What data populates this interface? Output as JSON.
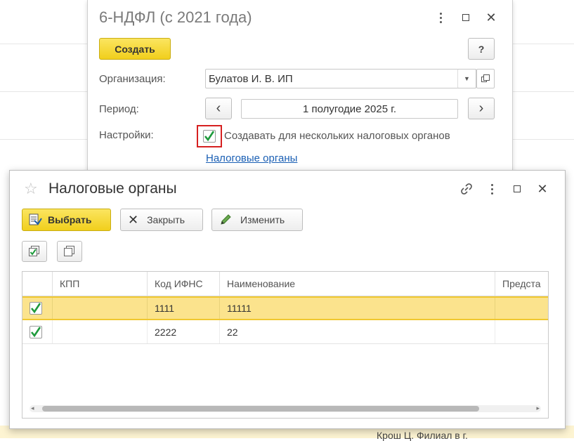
{
  "back_form": {
    "title": "6-НДФЛ (с 2021 года)",
    "create_label": "Создать",
    "help_label": "?",
    "org_label": "Организация:",
    "org_value": "Булатов И. В. ИП",
    "period_label": "Период:",
    "period_value": "1 полугодие 2025 г.",
    "prev_label": "‹",
    "next_label": "›",
    "settings_label": "Настройки:",
    "multi_checkbox_checked": true,
    "multi_checkbox_label": "Создавать для нескольких налоговых органов",
    "tax_link": "Налоговые органы"
  },
  "front_form": {
    "title": "Налоговые органы",
    "select_label": "Выбрать",
    "close_label": "Закрыть",
    "edit_label": "Изменить",
    "columns": [
      "КПП",
      "Код ИФНС",
      "Наименование",
      "Предста"
    ],
    "rows": [
      {
        "checked": true,
        "kpp": "",
        "code": "1111",
        "name": "11111",
        "rep": ""
      },
      {
        "checked": true,
        "kpp": "",
        "code": "2222",
        "name": "22",
        "rep": ""
      }
    ]
  },
  "background": {
    "bottom_text": "Крош Ц. Филиал в г."
  },
  "colors": {
    "accent_yellow": "#f5d830",
    "selected_row": "#fbe38d",
    "highlight_red": "#d62020",
    "check_green": "#1e9a3c",
    "link_blue": "#1a5fb4"
  }
}
